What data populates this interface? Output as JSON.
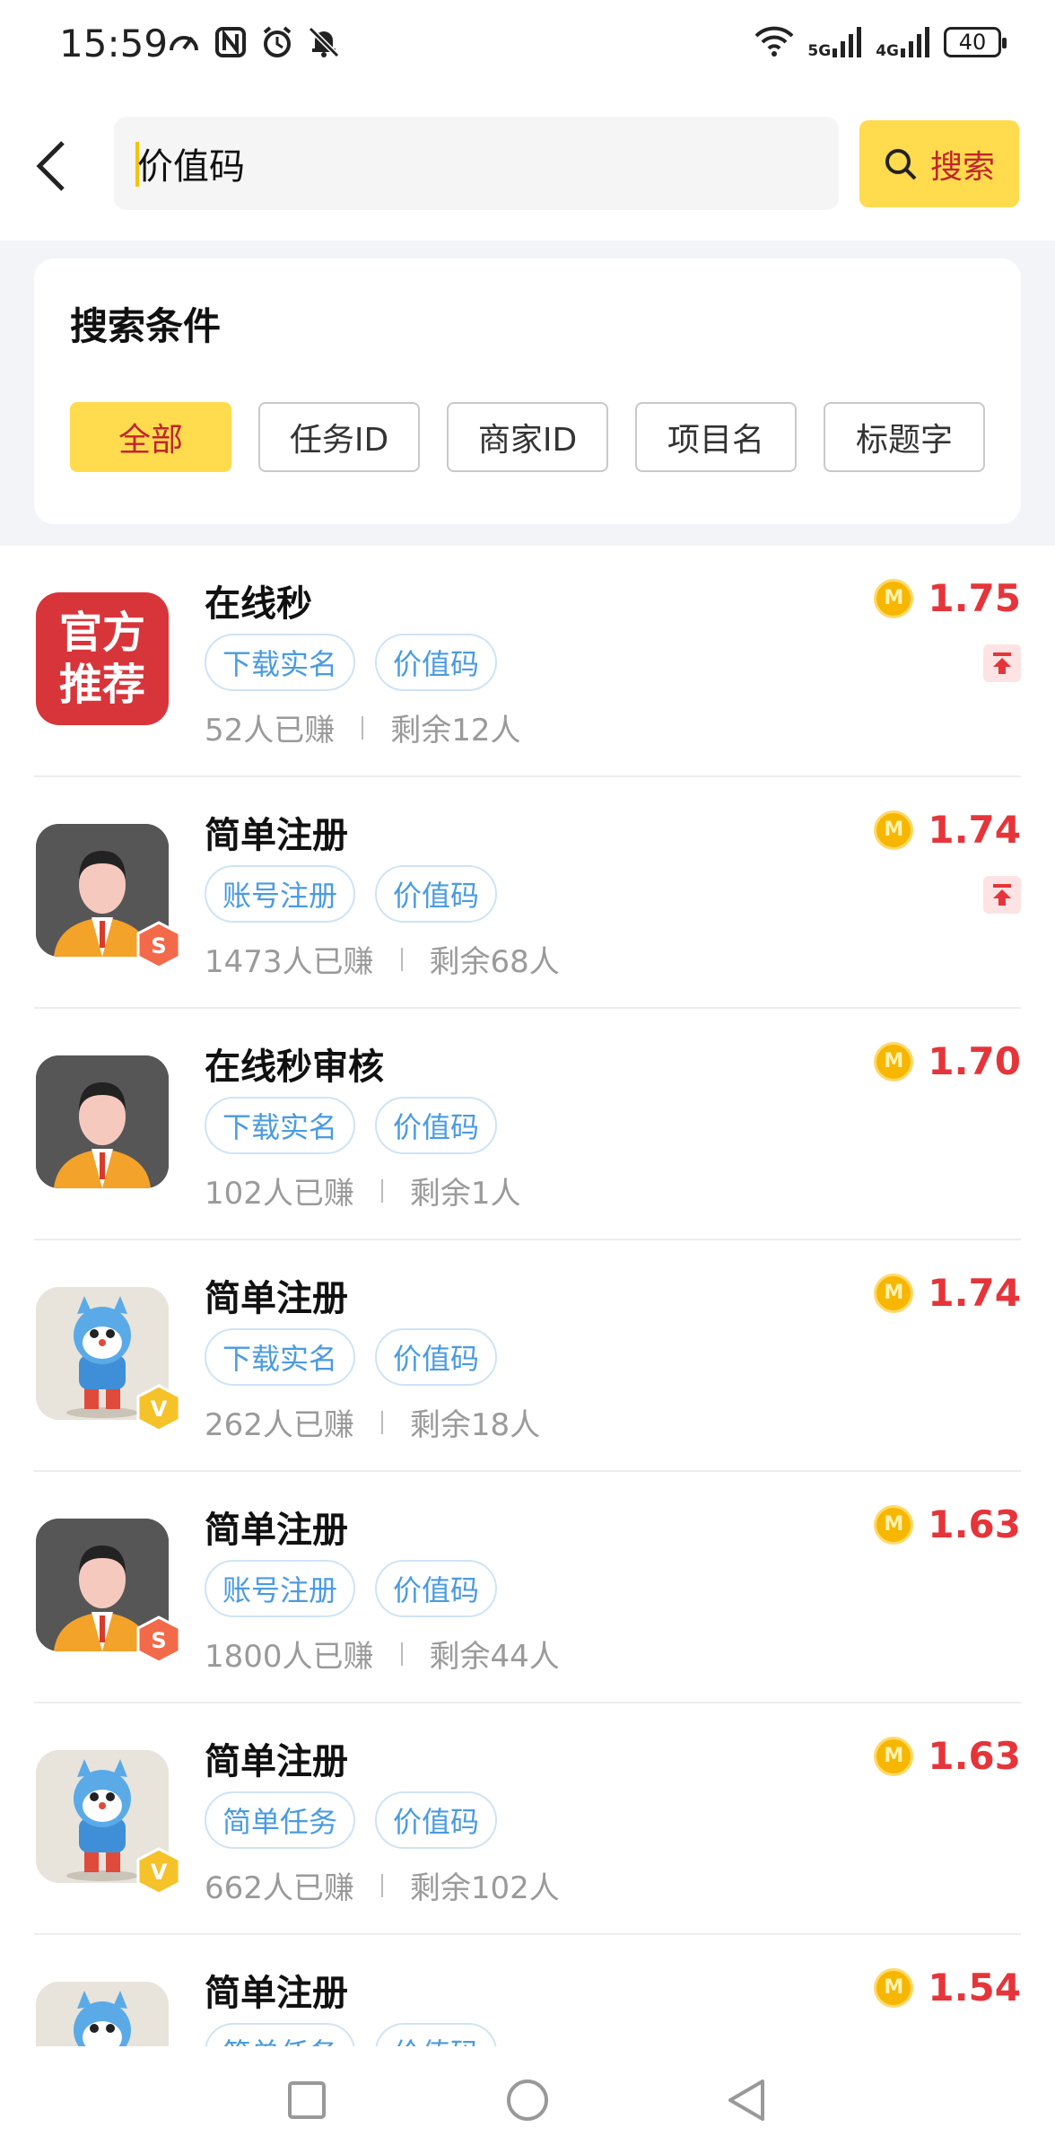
{
  "status_bar": {
    "time": "15:59",
    "left_icons": [
      "speed-icon",
      "nfc-icon",
      "alarm-icon",
      "mute-icon"
    ],
    "network_1": "5G",
    "network_2": "4G",
    "battery": "40"
  },
  "search": {
    "value": "价值码",
    "button_label": "搜索"
  },
  "filter": {
    "title": "搜索条件",
    "chips": [
      "全部",
      "任务ID",
      "商家ID",
      "项目名",
      "标题字"
    ],
    "active_index": 0
  },
  "tasks": [
    {
      "title": "在线秒",
      "tags": [
        "下载实名",
        "价值码"
      ],
      "earned": "52人已赚",
      "remaining": "剩余12人",
      "price": "1.75",
      "avatar": "official-recommend",
      "avatar_text": "官方推荐",
      "badge": null,
      "pinned": true
    },
    {
      "title": "简单注册",
      "tags": [
        "账号注册",
        "价值码"
      ],
      "earned": "1473人已赚",
      "remaining": "剩余68人",
      "price": "1.74",
      "avatar": "man",
      "badge": "S",
      "pinned": true
    },
    {
      "title": "在线秒审核",
      "tags": [
        "下载实名",
        "价值码"
      ],
      "earned": "102人已赚",
      "remaining": "剩余1人",
      "price": "1.70",
      "avatar": "man",
      "badge": null,
      "pinned": false
    },
    {
      "title": "简单注册",
      "tags": [
        "下载实名",
        "价值码"
      ],
      "earned": "262人已赚",
      "remaining": "剩余18人",
      "price": "1.74",
      "avatar": "cat",
      "badge": "V",
      "pinned": false
    },
    {
      "title": "简单注册",
      "tags": [
        "账号注册",
        "价值码"
      ],
      "earned": "1800人已赚",
      "remaining": "剩余44人",
      "price": "1.63",
      "avatar": "man",
      "badge": "S",
      "pinned": false
    },
    {
      "title": "简单注册",
      "tags": [
        "简单任务",
        "价值码"
      ],
      "earned": "662人已赚",
      "remaining": "剩余102人",
      "price": "1.63",
      "avatar": "cat",
      "badge": "V",
      "pinned": false
    },
    {
      "title": "简单注册",
      "tags": [
        "简单任务",
        "价值码"
      ],
      "earned": "",
      "remaining": "",
      "price": "1.54",
      "avatar": "cat",
      "badge": null,
      "pinned": false
    }
  ],
  "coin_letter": "M",
  "colors": {
    "accent_yellow": "#ffdb4d",
    "price_red": "#e5353a",
    "tag_blue": "#4a9be0"
  },
  "nav": [
    "square-icon",
    "circle-icon",
    "back-triangle-icon"
  ]
}
